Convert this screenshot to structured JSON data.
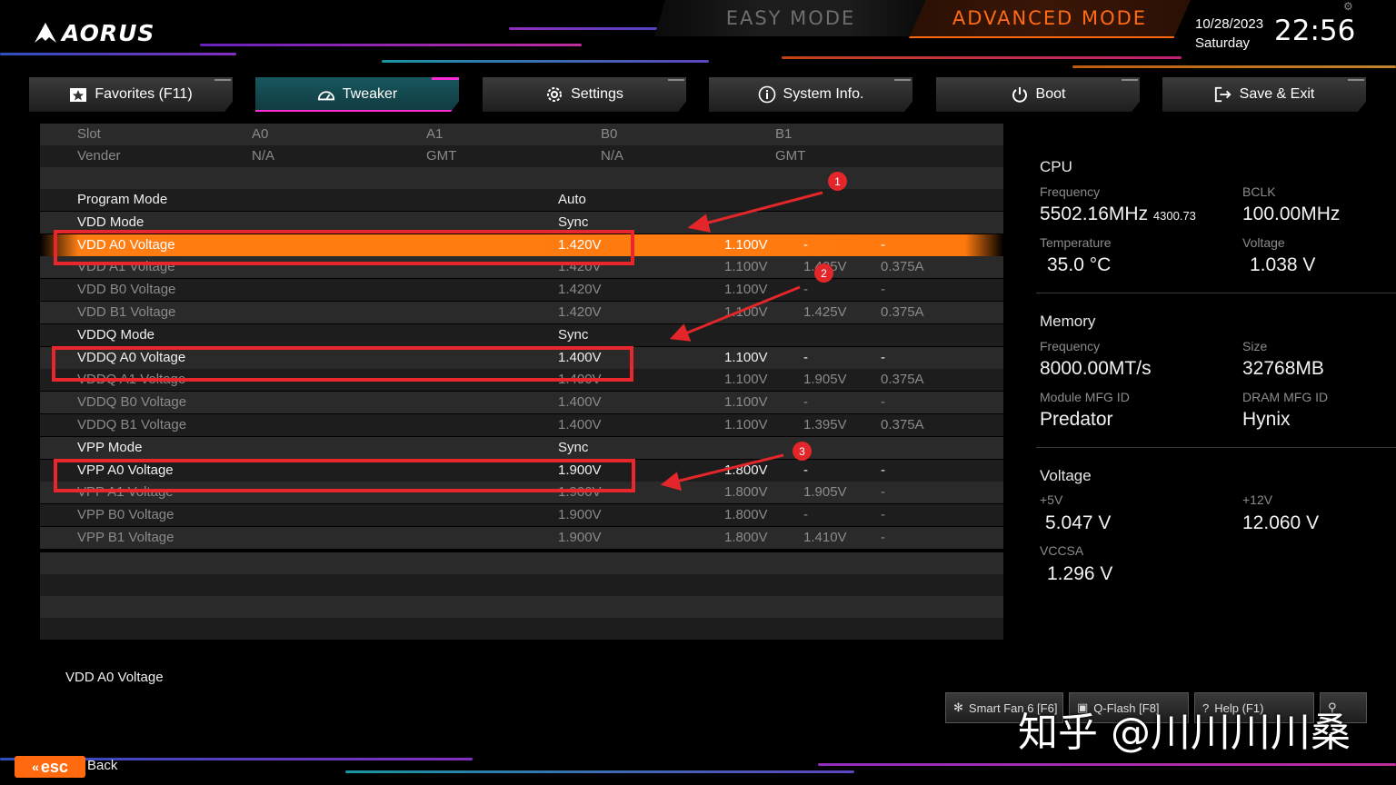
{
  "brand": {
    "logo_text": "AORUS",
    "accent": "#ff6a10",
    "highlight": "#ff7d12",
    "annotation": "#e8262b"
  },
  "modes": {
    "easy": "EASY MODE",
    "advanced": "ADVANCED MODE"
  },
  "datetime": {
    "date": "10/28/2023",
    "day": "Saturday",
    "time": "22:56"
  },
  "tabs": [
    {
      "label": "Favorites (F11)",
      "icon": "star-icon"
    },
    {
      "label": "Tweaker",
      "icon": "speedometer-icon"
    },
    {
      "label": "Settings",
      "icon": "gear-icon"
    },
    {
      "label": "System Info.",
      "icon": "info-icon"
    },
    {
      "label": "Boot",
      "icon": "power-icon"
    },
    {
      "label": "Save & Exit",
      "icon": "exit-icon"
    }
  ],
  "slot_table": {
    "rows": [
      [
        "Slot",
        "A0",
        "A1",
        "B0",
        "B1"
      ],
      [
        "Vender",
        "N/A",
        "GMT",
        "N/A",
        "GMT"
      ]
    ]
  },
  "settings": [
    {
      "name": "Program Mode",
      "value": "Auto",
      "default": "",
      "c3": "",
      "c4": ""
    },
    {
      "name": "VDD Mode",
      "value": "Sync",
      "default": "",
      "c3": "",
      "c4": ""
    },
    {
      "name": "VDD A0 Voltage",
      "value": "1.420V",
      "default": "1.100V",
      "c3": "-",
      "c4": "-"
    },
    {
      "name": "VDD A1 Voltage",
      "value": "1.420V",
      "default": "1.100V",
      "c3": "1.425V",
      "c4": "0.375A"
    },
    {
      "name": "VDD B0 Voltage",
      "value": "1.420V",
      "default": "1.100V",
      "c3": "-",
      "c4": "-"
    },
    {
      "name": "VDD B1 Voltage",
      "value": "1.420V",
      "default": "1.100V",
      "c3": "1.425V",
      "c4": "0.375A"
    },
    {
      "name": "VDDQ Mode",
      "value": "Sync",
      "default": "",
      "c3": "",
      "c4": ""
    },
    {
      "name": "VDDQ A0 Voltage",
      "value": "1.400V",
      "default": "1.100V",
      "c3": "-",
      "c4": "-"
    },
    {
      "name": "VDDQ A1 Voltage",
      "value": "1.400V",
      "default": "1.100V",
      "c3": "1.905V",
      "c4": "0.375A"
    },
    {
      "name": "VDDQ B0 Voltage",
      "value": "1.400V",
      "default": "1.100V",
      "c3": "-",
      "c4": "-"
    },
    {
      "name": "VDDQ B1 Voltage",
      "value": "1.400V",
      "default": "1.100V",
      "c3": "1.395V",
      "c4": "0.375A"
    },
    {
      "name": "VPP Mode",
      "value": "Sync",
      "default": "",
      "c3": "",
      "c4": ""
    },
    {
      "name": "VPP A0 Voltage",
      "value": "1.900V",
      "default": "1.800V",
      "c3": "-",
      "c4": "-"
    },
    {
      "name": "VPP A1 Voltage",
      "value": "1.900V",
      "default": "1.800V",
      "c3": "1.905V",
      "c4": "-"
    },
    {
      "name": "VPP B0 Voltage",
      "value": "1.900V",
      "default": "1.800V",
      "c3": "-",
      "c4": "-"
    },
    {
      "name": "VPP B1 Voltage",
      "value": "1.900V",
      "default": "1.800V",
      "c3": "1.410V",
      "c4": "-"
    }
  ],
  "annotations": [
    "1",
    "2",
    "3"
  ],
  "info": {
    "cpu": {
      "title": "CPU",
      "frequency_label": "Frequency",
      "frequency": "5502.16MHz",
      "frequency_sub": "4300.73",
      "bclk_label": "BCLK",
      "bclk": "100.00MHz",
      "temperature_label": "Temperature",
      "temperature": "35.0 °C",
      "voltage_label": "Voltage",
      "voltage": "1.038 V"
    },
    "memory": {
      "title": "Memory",
      "frequency_label": "Frequency",
      "frequency": "8000.00MT/s",
      "size_label": "Size",
      "size": "32768MB",
      "module_label": "Module MFG ID",
      "module": "Predator",
      "dram_label": "DRAM MFG ID",
      "dram": "Hynix"
    },
    "voltage": {
      "title": "Voltage",
      "p5_label": "+5V",
      "p5": "5.047 V",
      "p12_label": "+12V",
      "p12": "12.060 V",
      "vccsa_label": "VCCSA",
      "vccsa": "1.296 V"
    }
  },
  "help_text": "VDD A0 Voltage",
  "bottom_buttons": [
    {
      "label": "Smart Fan 6 [F6]",
      "icon": "fan-icon"
    },
    {
      "label": "Q-Flash [F8]",
      "icon": "chip-icon"
    },
    {
      "label": "Help (F1)",
      "icon": "help-icon"
    },
    {
      "label": "",
      "icon": "search-icon"
    }
  ],
  "watermark": "知乎 @川川川川桑",
  "esc": {
    "key": "esc",
    "label": "Back"
  }
}
